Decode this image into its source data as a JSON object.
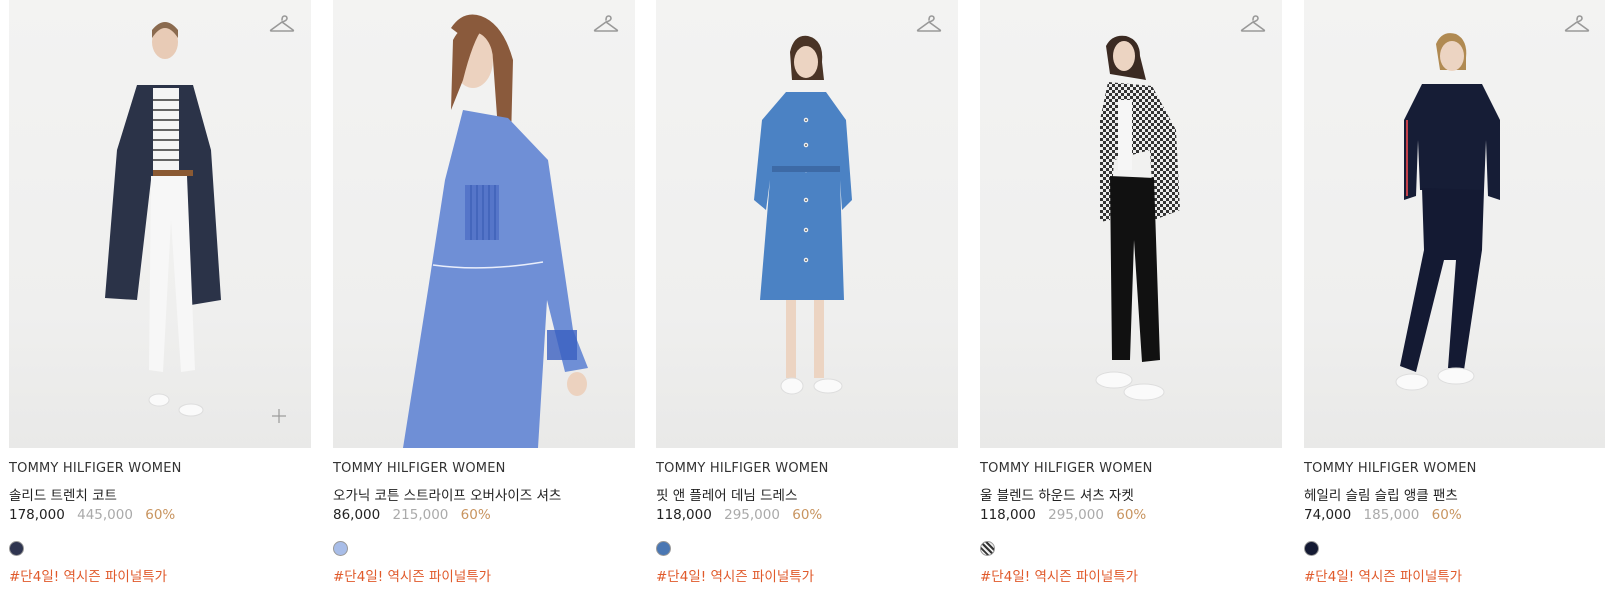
{
  "products": [
    {
      "brand": "TOMMY HILFIGER WOMEN",
      "name": "솔리드 트렌치 코트",
      "sale_price": "178,000",
      "original_price": "445,000",
      "discount": "60%",
      "swatch_color": "#2f3550",
      "promo": "#단4일! 역시즌 파이널특가",
      "show_plus_icon": true,
      "garment_color": "#2b3348"
    },
    {
      "brand": "TOMMY HILFIGER WOMEN",
      "name": "오가닉 코튼 스트라이프 오버사이즈 셔츠",
      "sale_price": "86,000",
      "original_price": "215,000",
      "discount": "60%",
      "swatch_color": "#a8bde8",
      "promo": "#단4일! 역시즌 파이널특가",
      "show_plus_icon": false,
      "garment_color": "#6f8fd6"
    },
    {
      "brand": "TOMMY HILFIGER WOMEN",
      "name": "핏 앤 플레어 데님 드레스",
      "sale_price": "118,000",
      "original_price": "295,000",
      "discount": "60%",
      "swatch_color": "#4a77b3",
      "promo": "#단4일! 역시즌 파이널특가",
      "show_plus_icon": false,
      "garment_color": "#4b82c4"
    },
    {
      "brand": "TOMMY HILFIGER WOMEN",
      "name": "울 블렌드 하운드 셔츠 자켓",
      "sale_price": "118,000",
      "original_price": "295,000",
      "discount": "60%",
      "swatch_color": "checked",
      "promo": "#단4일! 역시즌 파이널특가",
      "show_plus_icon": false,
      "garment_color": "#555555"
    },
    {
      "brand": "TOMMY HILFIGER WOMEN",
      "name": "헤일리 슬림 슬립 앵클 팬츠",
      "sale_price": "74,000",
      "original_price": "185,000",
      "discount": "60%",
      "swatch_color": "#141a33",
      "promo": "#단4일! 역시즌 파이널특가",
      "show_plus_icon": false,
      "garment_color": "#161d36"
    }
  ]
}
